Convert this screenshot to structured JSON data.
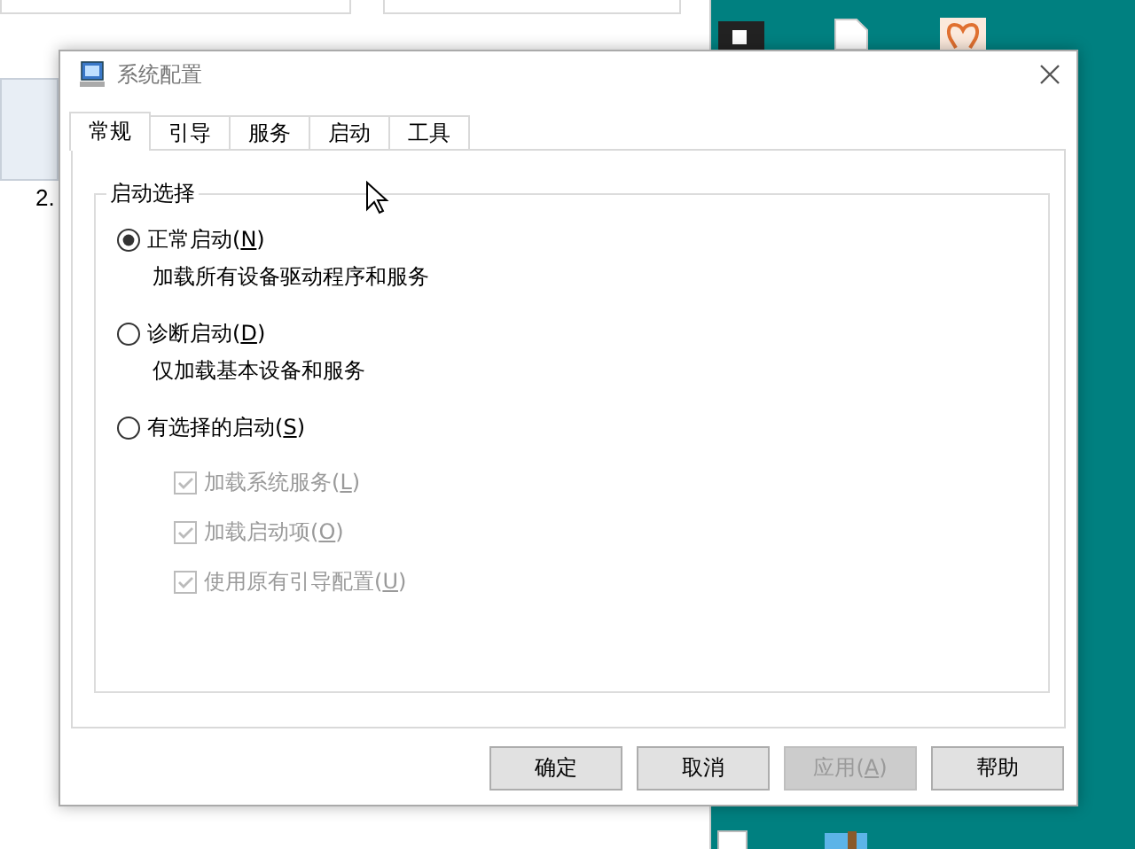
{
  "background": {
    "file_label": "2."
  },
  "dialog": {
    "title": "系统配置",
    "tabs": [
      {
        "label": "常规",
        "selected": true
      },
      {
        "label": "引导",
        "selected": false
      },
      {
        "label": "服务",
        "selected": false
      },
      {
        "label": "启动",
        "selected": false
      },
      {
        "label": "工具",
        "selected": false
      }
    ],
    "group": {
      "title": "启动选择",
      "options": [
        {
          "kind": "radio",
          "label": "正常启动(N)",
          "selected": true,
          "description": "加载所有设备驱动程序和服务"
        },
        {
          "kind": "radio",
          "label": "诊断启动(D)",
          "selected": false,
          "description": "仅加载基本设备和服务"
        },
        {
          "kind": "radio",
          "label": "有选择的启动(S)",
          "selected": false
        },
        {
          "kind": "checkbox",
          "label": "加载系统服务(L)",
          "checked": true,
          "disabled": true
        },
        {
          "kind": "checkbox",
          "label": "加载启动项(O)",
          "checked": true,
          "disabled": true
        },
        {
          "kind": "checkbox",
          "label": "使用原有引导配置(U)",
          "checked": true,
          "disabled": true
        }
      ]
    },
    "buttons": [
      {
        "label": "确定",
        "disabled": false
      },
      {
        "label": "取消",
        "disabled": false
      },
      {
        "label": "应用(A)",
        "disabled": true
      },
      {
        "label": "帮助",
        "disabled": false
      }
    ]
  }
}
